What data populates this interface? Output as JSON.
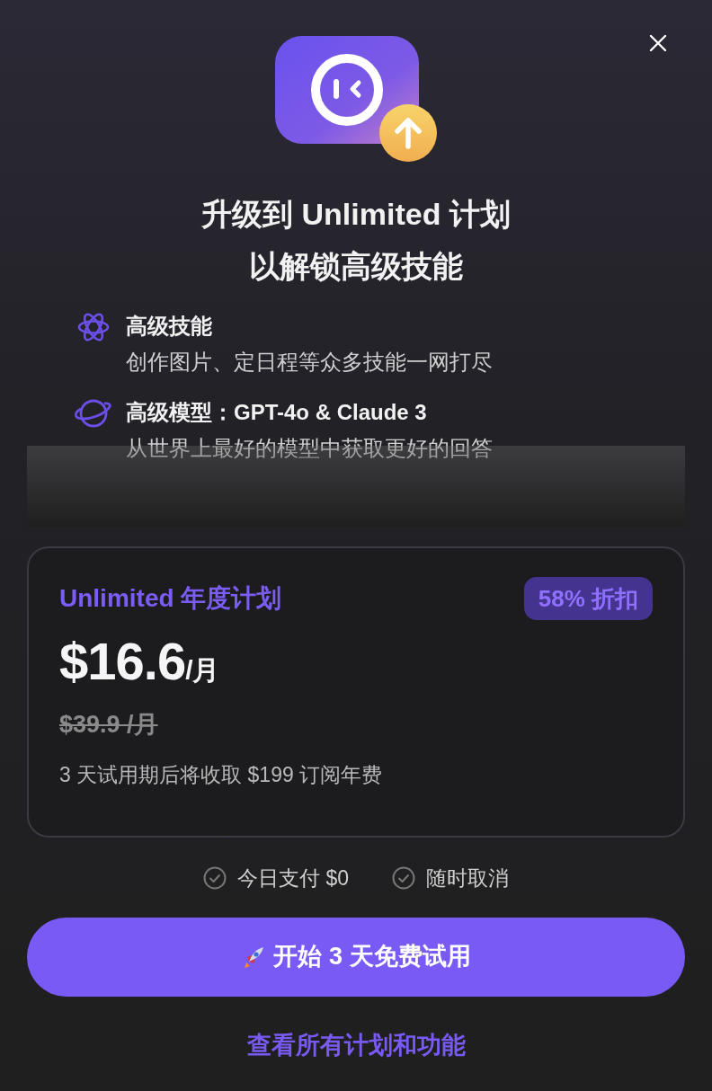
{
  "dialog": {
    "title_lines": [
      "升级到 Unlimited 计划",
      "以解锁高级技能"
    ]
  },
  "features": [
    {
      "kind": "atom",
      "title": "高级技能",
      "description": "创作图片、定日程等众多技能一网打尽"
    },
    {
      "kind": "planet",
      "title": "高级模型：GPT-4o & Claude 3",
      "description": "从世界上最好的模型中获取更好的回答"
    }
  ],
  "plan": {
    "name": "Unlimited 年度计划",
    "discount": "58% 折扣",
    "price": "$16.6",
    "price_unit": "/月",
    "original_price": "$39.9 /月",
    "note": "3 天试用期后将收取 $199 订阅年费"
  },
  "assurances": [
    "今日支付 $0",
    "随时取消"
  ],
  "cta": {
    "label": "开始 3 天免费试用"
  },
  "link": "查看所有计划和功能"
}
